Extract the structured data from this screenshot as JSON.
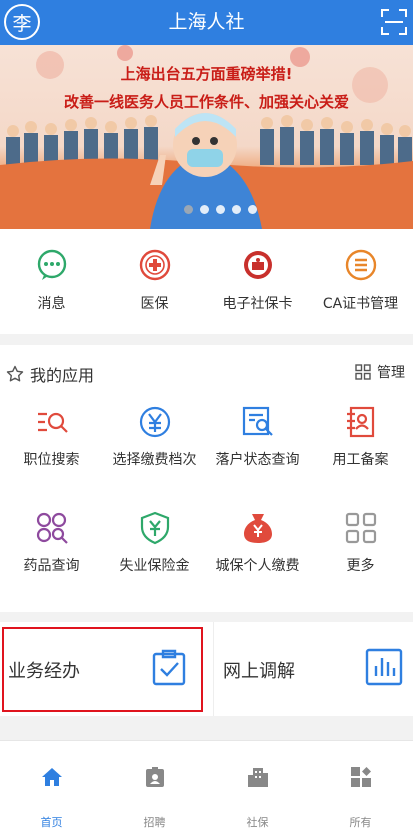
{
  "header": {
    "avatar_text": "李",
    "title": "上海人社"
  },
  "banner": {
    "line1": "上海出台五方面重磅举措!",
    "line2": "改善一线医务人员工作条件、加强关心关爱",
    "slide_count": 5,
    "active_slide": 1
  },
  "quick": [
    {
      "label": "消息",
      "icon": "message-icon"
    },
    {
      "label": "医保",
      "icon": "medical-insurance-icon"
    },
    {
      "label": "电子社保卡",
      "icon": "social-security-card-icon"
    },
    {
      "label": "CA证书管理",
      "icon": "ca-certificate-icon"
    }
  ],
  "apps": {
    "title": "我的应用",
    "manage_label": "管理",
    "items": [
      {
        "label": "职位搜索",
        "icon": "job-search-icon"
      },
      {
        "label": "选择缴费档次",
        "icon": "payment-level-icon"
      },
      {
        "label": "落户状态查询",
        "icon": "residency-status-icon"
      },
      {
        "label": "用工备案",
        "icon": "employment-record-icon"
      },
      {
        "label": "药品查询",
        "icon": "drug-query-icon"
      },
      {
        "label": "失业保险金",
        "icon": "unemployment-insurance-icon"
      },
      {
        "label": "城保个人缴费",
        "icon": "personal-payment-icon"
      },
      {
        "label": "更多",
        "icon": "more-icon"
      }
    ]
  },
  "services": [
    {
      "label": "业务经办",
      "icon": "clipboard-check-icon",
      "highlighted": true
    },
    {
      "label": "网上调解",
      "icon": "bar-chart-icon",
      "highlighted": false
    }
  ],
  "tabbar": [
    {
      "label": "首页",
      "icon": "home-icon",
      "active": true
    },
    {
      "label": "招聘",
      "icon": "recruit-icon",
      "active": false
    },
    {
      "label": "社保",
      "icon": "social-security-icon",
      "active": false
    },
    {
      "label": "所有",
      "icon": "all-icon",
      "active": false
    }
  ],
  "colors": {
    "brand_blue": "#2f7fe0",
    "highlight_red": "#e0141e",
    "banner_text_red": "#c91d17"
  }
}
